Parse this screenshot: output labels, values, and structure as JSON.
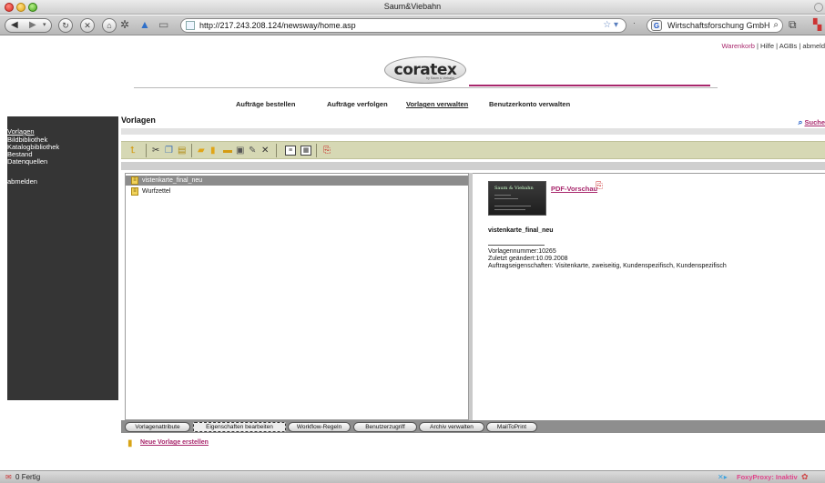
{
  "window": {
    "title": "Saum&Viebahn"
  },
  "browser": {
    "url": "http://217.243.208.124/newsway/home.asp",
    "search_text": "Wirtschaftsforschung GmbH"
  },
  "top_links": {
    "cart": "Warenkorb",
    "rest": " | Hilfe | AGBs | abmeld"
  },
  "logo": {
    "brand": "coratex",
    "sub": "by Saum & Viebahn"
  },
  "main_nav": [
    {
      "label": "Aufträge bestellen"
    },
    {
      "label": "Aufträge verfolgen"
    },
    {
      "label": "Vorlagen verwalten",
      "active": true
    },
    {
      "label": "Benutzerkonto verwalten"
    }
  ],
  "sidebar": {
    "items": [
      {
        "label": "Vorlagen",
        "active": true
      },
      {
        "label": "Bildbibliothek"
      },
      {
        "label": "Katalogbibliothek"
      },
      {
        "label": "Bestand"
      },
      {
        "label": "Datenquellen"
      },
      {
        "label": "abmelden"
      }
    ]
  },
  "page": {
    "heading": "Vorlagen",
    "search_link": "Suche"
  },
  "toolbar_icons": [
    "up-folder-icon",
    "cut-icon",
    "copy-icon",
    "paste-icon",
    "new-folder-icon",
    "new-template-icon",
    "folder-icon",
    "edit-icon",
    "rename-icon",
    "delete-icon",
    "list-view-icon",
    "thumbnail-view-icon",
    "pdf-icon"
  ],
  "templates": [
    {
      "name": "vistenkarte_final_neu",
      "selected": true
    },
    {
      "name": "Wurfzettel",
      "selected": false
    }
  ],
  "detail": {
    "thumb_text": "Saum & Viebahn",
    "pdf_preview": "PDF-Vorschau",
    "title": "vistenkarte_final_neu",
    "number": "Vorlagennummer:10265",
    "changed": "Zuletzt geändert:10.09.2008",
    "properties": "Auftragseigenschaften: Visitenkarte, zweiseitig, Kundenspezifisch, Kundenspezifisch"
  },
  "bottom_tabs": [
    {
      "label": "Vorlagenattribute"
    },
    {
      "label": "Eigenschaften bearbeiten",
      "active": true
    },
    {
      "label": "Workflow-Regeln"
    },
    {
      "label": "Benutzerzugriff"
    },
    {
      "label": "Archiv verwalten"
    },
    {
      "label": "MailToPrint"
    }
  ],
  "new_template_link": "Neue Vorlage erstellen",
  "status": {
    "mail_count": "0",
    "text": "Fertig",
    "foxyproxy": "FoxyProxy: Inaktiv"
  },
  "colors": {
    "accent": "#a8276c",
    "sidebar": "#353535",
    "iconbar": "#d6d8b4"
  }
}
